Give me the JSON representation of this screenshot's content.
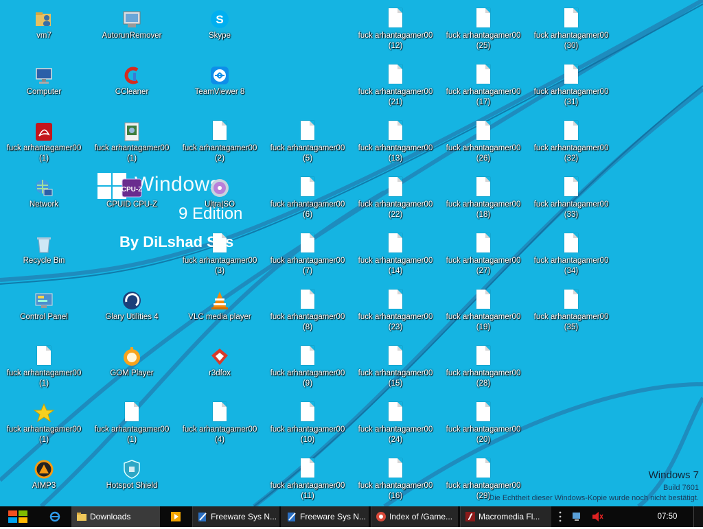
{
  "branding": {
    "word": "Windows",
    "edition": "9 Edition",
    "by": "By DiLshad Sys"
  },
  "icons": [
    {
      "label": "vm7",
      "icon": "folder-user-icon"
    },
    {
      "label": "Computer",
      "icon": "computer-icon"
    },
    {
      "label": "fuck arhantagamer00\n(1)",
      "icon": "pdf-icon"
    },
    {
      "label": "Network",
      "icon": "network-globe-icon"
    },
    {
      "label": "Recycle Bin",
      "icon": "recycle-bin-icon"
    },
    {
      "label": "Control Panel",
      "icon": "control-panel-icon"
    },
    {
      "label": "fuck arhantagamer00\n(1)",
      "icon": "document-icon"
    },
    {
      "label": "fuck arhantagamer00\n(1)",
      "icon": "star-icon"
    },
    {
      "label": "AIMP3",
      "icon": "aimp-icon"
    },
    {
      "label": "AutorunRemover",
      "icon": "autorun-remover-icon"
    },
    {
      "label": "CCleaner",
      "icon": "ccleaner-icon"
    },
    {
      "label": "fuck arhantagamer00\n(1)",
      "icon": "setup-icon"
    },
    {
      "label": "CPUID CPU-Z",
      "icon": "cpuz-icon"
    },
    {
      "label": "Glary Utilities 4",
      "icon": "glary-icon"
    },
    {
      "label": "GOM Player",
      "icon": "gom-player-icon"
    },
    {
      "label": "fuck arhantagamer00\n(1)",
      "icon": "document-icon"
    },
    {
      "label": "Hotspot Shield",
      "icon": "shield-icon"
    },
    {
      "label": "Skype",
      "icon": "skype-icon"
    },
    {
      "label": "TeamViewer 8",
      "icon": "teamviewer-icon"
    },
    {
      "label": "fuck arhantagamer00\n(2)",
      "icon": "document-icon"
    },
    {
      "label": "UltraISO",
      "icon": "disc-icon"
    },
    {
      "label": "fuck arhantagamer00\n(3)",
      "icon": "document-icon"
    },
    {
      "label": "VLC media player",
      "icon": "vlc-cone-icon"
    },
    {
      "label": "r3dfox",
      "icon": "r3dfox-icon"
    },
    {
      "label": "fuck arhantagamer00\n(4)",
      "icon": "document-icon"
    },
    {
      "label": "fuck arhantagamer00\n(5)",
      "icon": "document-icon"
    },
    {
      "label": "fuck arhantagamer00\n(6)",
      "icon": "document-icon"
    },
    {
      "label": "fuck arhantagamer00\n(7)",
      "icon": "document-icon"
    },
    {
      "label": "fuck arhantagamer00\n(8)",
      "icon": "document-icon"
    },
    {
      "label": "fuck arhantagamer00\n(9)",
      "icon": "document-icon"
    },
    {
      "label": "fuck arhantagamer00\n(10)",
      "icon": "document-icon"
    },
    {
      "label": "fuck arhantagamer00\n(11)",
      "icon": "document-icon"
    },
    {
      "label": "fuck arhantagamer00\n(12)",
      "icon": "document-icon"
    },
    {
      "label": "fuck arhantagamer00\n(21)",
      "icon": "document-icon"
    },
    {
      "label": "fuck arhantagamer00\n(13)",
      "icon": "document-icon"
    },
    {
      "label": "fuck arhantagamer00\n(22)",
      "icon": "document-icon"
    },
    {
      "label": "fuck arhantagamer00\n(14)",
      "icon": "document-icon"
    },
    {
      "label": "fuck arhantagamer00\n(23)",
      "icon": "document-icon"
    },
    {
      "label": "fuck arhantagamer00\n(15)",
      "icon": "document-icon"
    },
    {
      "label": "fuck arhantagamer00\n(24)",
      "icon": "document-icon"
    },
    {
      "label": "fuck arhantagamer00\n(16)",
      "icon": "document-icon"
    },
    {
      "label": "fuck arhantagamer00\n(25)",
      "icon": "document-icon"
    },
    {
      "label": "fuck arhantagamer00\n(17)",
      "icon": "document-icon"
    },
    {
      "label": "fuck arhantagamer00\n(26)",
      "icon": "document-icon"
    },
    {
      "label": "fuck arhantagamer00\n(18)",
      "icon": "document-icon"
    },
    {
      "label": "fuck arhantagamer00\n(27)",
      "icon": "document-icon"
    },
    {
      "label": "fuck arhantagamer00\n(19)",
      "icon": "document-icon"
    },
    {
      "label": "fuck arhantagamer00\n(28)",
      "icon": "document-icon"
    },
    {
      "label": "fuck arhantagamer00\n(20)",
      "icon": "document-icon"
    },
    {
      "label": "fuck arhantagamer00\n(29)",
      "icon": "document-icon"
    },
    {
      "label": "fuck arhantagamer00\n(30)",
      "icon": "document-icon"
    },
    {
      "label": "fuck arhantagamer00\n(31)",
      "icon": "document-icon"
    },
    {
      "label": "fuck arhantagamer00\n(32)",
      "icon": "document-icon"
    },
    {
      "label": "fuck arhantagamer00\n(33)",
      "icon": "document-icon"
    },
    {
      "label": "fuck arhantagamer00\n(34)",
      "icon": "document-icon"
    },
    {
      "label": "fuck arhantagamer00\n(35)",
      "icon": "document-icon"
    }
  ],
  "watermark": {
    "os": "Windows 7",
    "build": "Build 7601",
    "notice": "Die Echtheit dieser Windows-Kopie wurde noch nicht bestätigt."
  },
  "taskbar": {
    "items": [
      {
        "label": "",
        "icon": "internet-explorer-icon"
      },
      {
        "label": "Downloads",
        "icon": "folder-icon"
      },
      {
        "label": "",
        "icon": "media-player-icon"
      },
      {
        "label": "Freeware Sys N...",
        "icon": "notepad-pen-icon"
      },
      {
        "label": "Freeware Sys N...",
        "icon": "notepad-pen-icon"
      },
      {
        "label": "Index of /Game...",
        "icon": "browser-icon"
      },
      {
        "label": "Macromedia Fl...",
        "icon": "flash-icon"
      }
    ],
    "clock": "07:50"
  },
  "colors": {
    "desktop": "#15b4e2",
    "taskbar": "#0a0a0a",
    "accent_lines": "#1f7fb0"
  }
}
